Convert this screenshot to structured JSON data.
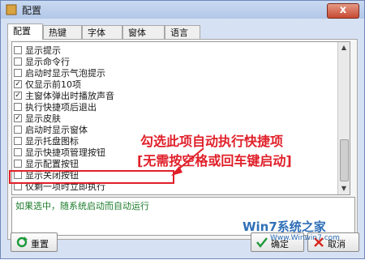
{
  "window": {
    "title": "配置",
    "close_label": "x"
  },
  "tabs": [
    {
      "label": "配置",
      "active": true
    },
    {
      "label": "热键",
      "active": false
    },
    {
      "label": "字体",
      "active": false
    },
    {
      "label": "窗体",
      "active": false
    },
    {
      "label": "语言",
      "active": false
    }
  ],
  "options": [
    {
      "label": "显示提示",
      "checked": false
    },
    {
      "label": "显示命令行",
      "checked": false
    },
    {
      "label": "启动时显示气泡提示",
      "checked": false
    },
    {
      "label": "仅显示前10项",
      "checked": true
    },
    {
      "label": "主窗体弹出时播放声音",
      "checked": true
    },
    {
      "label": "执行快捷项后退出",
      "checked": false
    },
    {
      "label": "显示皮肤",
      "checked": true
    },
    {
      "label": "启动时显示窗体",
      "checked": false
    },
    {
      "label": "显示托盘图标",
      "checked": false
    },
    {
      "label": "显示快捷项管理按钮",
      "checked": false
    },
    {
      "label": "显示配置按钮",
      "checked": false
    },
    {
      "label": "显示关闭按钮",
      "checked": false
    },
    {
      "label": "仅剩一项时立即执行",
      "checked": false
    }
  ],
  "annotation": {
    "line1": "勾选此项自动执行快捷项",
    "line2": "[无需按空格或回车键启动]"
  },
  "description": "如果选中，随系统启动而自动运行",
  "buttons": {
    "reset": "重置",
    "ok": "确定",
    "cancel": "取消"
  },
  "watermark": {
    "main": "Win7系统之家",
    "sub": "Www.Winwin7.com"
  },
  "colors": {
    "annotation": "#e0202a",
    "description_text": "#1e7d2d",
    "title_bg": "#c9d9f1"
  }
}
